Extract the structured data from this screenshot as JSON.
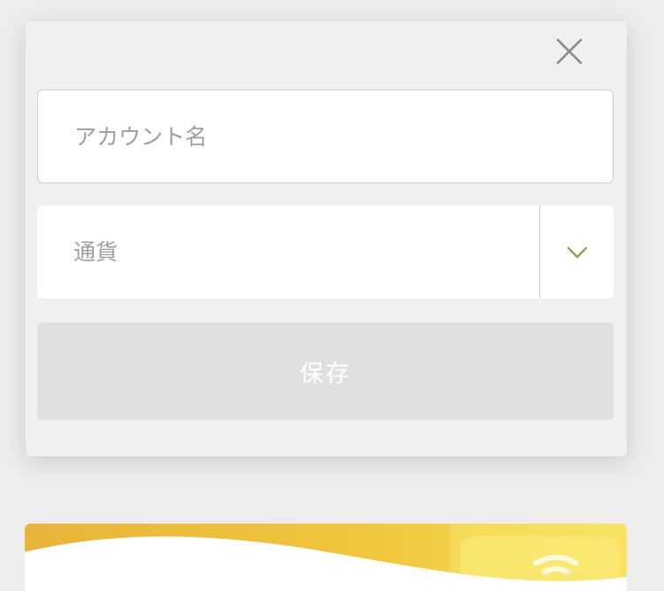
{
  "modal": {
    "close_icon": "close-icon",
    "account_name": {
      "placeholder": "アカウント名",
      "value": ""
    },
    "currency": {
      "label": "通貨",
      "dropdown_icon": "chevron-down-icon"
    },
    "save_label": "保存"
  },
  "colors": {
    "background": "#ededed",
    "modal": "#f0f0f0",
    "save_button": "#e0e0e0",
    "chevron": "#8aa84a",
    "card_gradient_start": "#e8b43a",
    "card_gradient_end": "#f6e15a"
  }
}
